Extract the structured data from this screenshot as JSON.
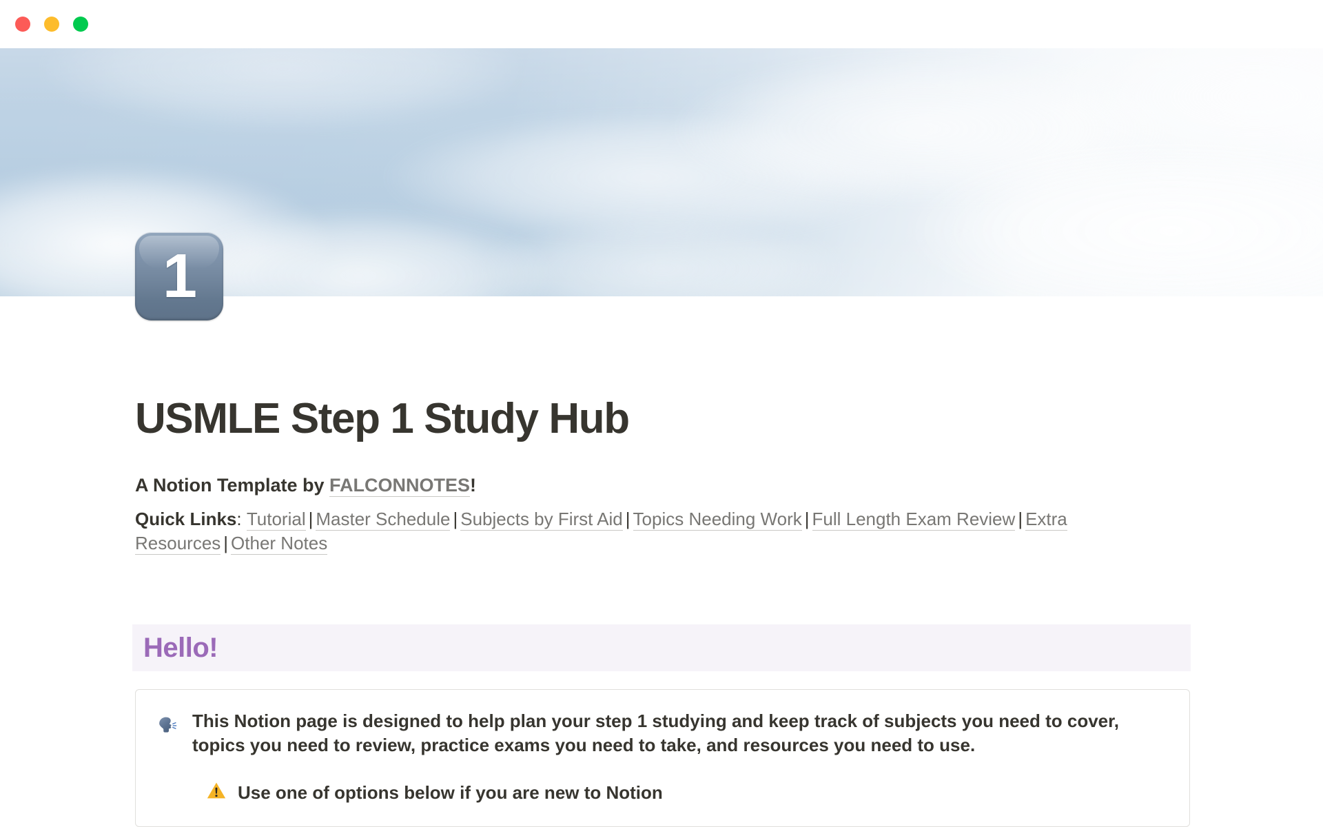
{
  "window": {
    "traffic_lights": [
      {
        "name": "close",
        "color": "#fc5b57"
      },
      {
        "name": "minimize",
        "color": "#fdbc2c"
      },
      {
        "name": "zoom",
        "color": "#00ca4e"
      }
    ]
  },
  "cover": {
    "description": "blue sky with clouds",
    "base_color": "#b9cfe2"
  },
  "page": {
    "icon": "keycap-1-emoji",
    "icon_number": "1",
    "title": "USMLE Step 1 Study Hub"
  },
  "byline": {
    "prefix": "A Notion Template by ",
    "author": "FALCONNOTES",
    "suffix": "!"
  },
  "quick_links": {
    "label": "Quick Links",
    "colon": ":",
    "separator": "|",
    "items": [
      {
        "label": "Tutorial"
      },
      {
        "label": "Master Schedule"
      },
      {
        "label": "Subjects by First Aid"
      },
      {
        "label": "Topics Needing Work"
      },
      {
        "label": "Full Length Exam Review"
      },
      {
        "label": "Extra Resources"
      },
      {
        "label": "Other Notes"
      }
    ]
  },
  "hello_banner": {
    "text": "Hello!",
    "text_color": "#9b6ab8",
    "background_color": "#f6f3f9"
  },
  "callout": {
    "emoji": "speaking-head-emoji",
    "text": "This Notion page is designed to help plan your step 1 studying and keep track of subjects you need to cover, topics you need to review, practice exams you need to take, and resources you need to use.",
    "sub_emoji": "warning-emoji",
    "sub_text": "Use one of options below if you are new to Notion"
  }
}
